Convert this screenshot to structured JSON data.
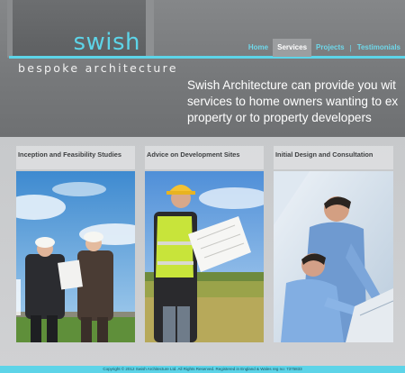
{
  "brand": {
    "logo_text": "swish",
    "tagline": "bespoke architecture"
  },
  "nav": {
    "items": [
      {
        "label": "Home"
      },
      {
        "label": "Services"
      },
      {
        "label": "Projects"
      },
      {
        "label": "Testimonials"
      }
    ],
    "active": "Services"
  },
  "hero": {
    "headline": "Swish Architecture can provide you wit\nservices to home owners wanting to ex\nproperty or to property developers"
  },
  "services": [
    {
      "title": "Inception and Feasibility Studies",
      "image": "architects-on-site-photo"
    },
    {
      "title": "Advice on Development Sites",
      "image": "engineer-with-plans-photo"
    },
    {
      "title": "Initial Design and Consultation",
      "image": "designers-at-desk-photo"
    }
  ],
  "footer": {
    "copyright": "Copyright © 2012 Swish Architecture Ltd. All Rights Reserved. Registered in England & Wales reg no: 7375833"
  },
  "colors": {
    "accent": "#5dd4e8",
    "header_bg": "#7a7c7e",
    "content_bg": "#cbcdcf"
  }
}
